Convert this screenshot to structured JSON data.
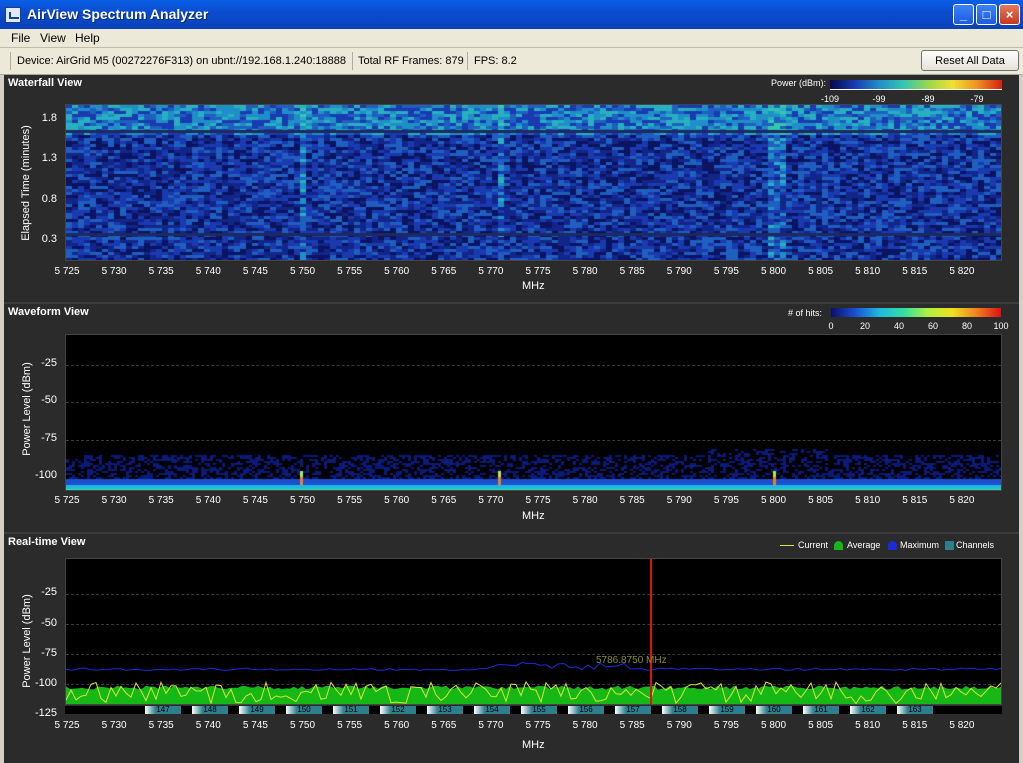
{
  "window": {
    "title": "AirView Spectrum Analyzer"
  },
  "menu": {
    "items": [
      "File",
      "View",
      "Help"
    ]
  },
  "toolbar": {
    "device": "Device: AirGrid M5 (00272276F313) on ubnt://192.168.1.240:18888",
    "frames": "Total RF Frames: 879",
    "fps": "FPS: 8.2",
    "reset_label": "Reset All Data"
  },
  "waterfall": {
    "title": "Waterfall View",
    "legend_label": "Power (dBm):",
    "legend_scale": [
      "-109",
      "-99",
      "-89",
      "-79"
    ],
    "ylabel": "Elapsed Time (minutes)",
    "yticks": [
      "1.8",
      "1.3",
      "0.8",
      "0.3"
    ],
    "xlabel": "MHz"
  },
  "waveform": {
    "title": "Waveform View",
    "legend_label": "# of hits:",
    "legend_scale": [
      "0",
      "20",
      "40",
      "60",
      "80",
      "100"
    ],
    "ylabel": "Power Level (dBm)",
    "yticks": [
      "-25",
      "-50",
      "-75",
      "-100"
    ],
    "xlabel": "MHz"
  },
  "realtime": {
    "title": "Real-time View",
    "legend": [
      "Current",
      "Average",
      "Maximum",
      "Channels"
    ],
    "ylabel": "Power Level (dBm)",
    "yticks": [
      "-25",
      "-50",
      "-75",
      "-100",
      "-125"
    ],
    "xlabel": "MHz",
    "cursor_label": "5786.8750 MHz",
    "channels": [
      "147",
      "148",
      "149",
      "150",
      "151",
      "152",
      "153",
      "154",
      "155",
      "156",
      "157",
      "158",
      "159",
      "160",
      "161",
      "162",
      "163"
    ]
  },
  "x_ticks": [
    "5 725",
    "5 730",
    "5 735",
    "5 740",
    "5 745",
    "5 750",
    "5 755",
    "5 760",
    "5 765",
    "5 770",
    "5 775",
    "5 780",
    "5 785",
    "5 790",
    "5 795",
    "5 800",
    "5 805",
    "5 810",
    "5 815",
    "5 820"
  ],
  "colors": {
    "titlebar": "#0a4cd0",
    "current": "#d8e63a",
    "average": "#16b816",
    "maximum": "#1a2bd8",
    "cursor": "#e01010",
    "channels": "#2e7f8e"
  },
  "chart_data": [
    {
      "type": "heatmap",
      "title": "Waterfall View",
      "xlabel": "MHz",
      "ylabel": "Elapsed Time (minutes)",
      "xlim": [
        5723,
        5825
      ],
      "ylim": [
        0,
        2.0
      ],
      "color_scale": [
        -109,
        -79
      ]
    },
    {
      "type": "heatmap",
      "title": "Waveform View",
      "xlabel": "MHz",
      "ylabel": "Power Level (dBm)",
      "xlim": [
        5723,
        5825
      ],
      "ylim": [
        -110,
        -5
      ],
      "color_scale": [
        0,
        100
      ]
    },
    {
      "type": "line",
      "title": "Real-time View",
      "xlabel": "MHz",
      "ylabel": "Power Level (dBm)",
      "xlim": [
        5723,
        5825
      ],
      "ylim": [
        -130,
        -10
      ],
      "series": [
        {
          "name": "Current",
          "y_range": [
            -128,
            -110
          ]
        },
        {
          "name": "Average",
          "values_approx": -115
        },
        {
          "name": "Maximum",
          "values_approx": -100
        }
      ],
      "cursor_mhz": 5786.875
    }
  ]
}
